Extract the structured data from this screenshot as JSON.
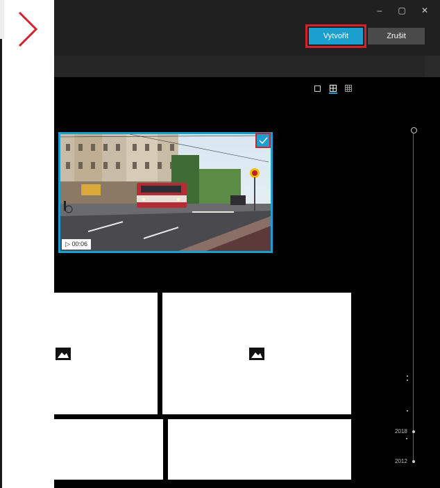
{
  "window": {
    "controls": {
      "minimize": "–",
      "restore": "▢",
      "close": "✕"
    }
  },
  "toolbar": {
    "create_label": "Vytvořit",
    "cancel_label": "Zrušit"
  },
  "view_modes": [
    "single-view-icon",
    "medium-grid-icon",
    "small-grid-icon"
  ],
  "gallery": {
    "video": {
      "duration": "00:06",
      "selected": true
    },
    "photos": [
      "placeholder-image",
      "placeholder-image",
      "placeholder-image",
      "placeholder-image"
    ]
  },
  "timeline": {
    "years": [
      "2018",
      "2012"
    ]
  },
  "colors": {
    "accent": "#1a9fce",
    "highlight": "#d4202a",
    "background": "#000000",
    "chrome": "#202020"
  }
}
